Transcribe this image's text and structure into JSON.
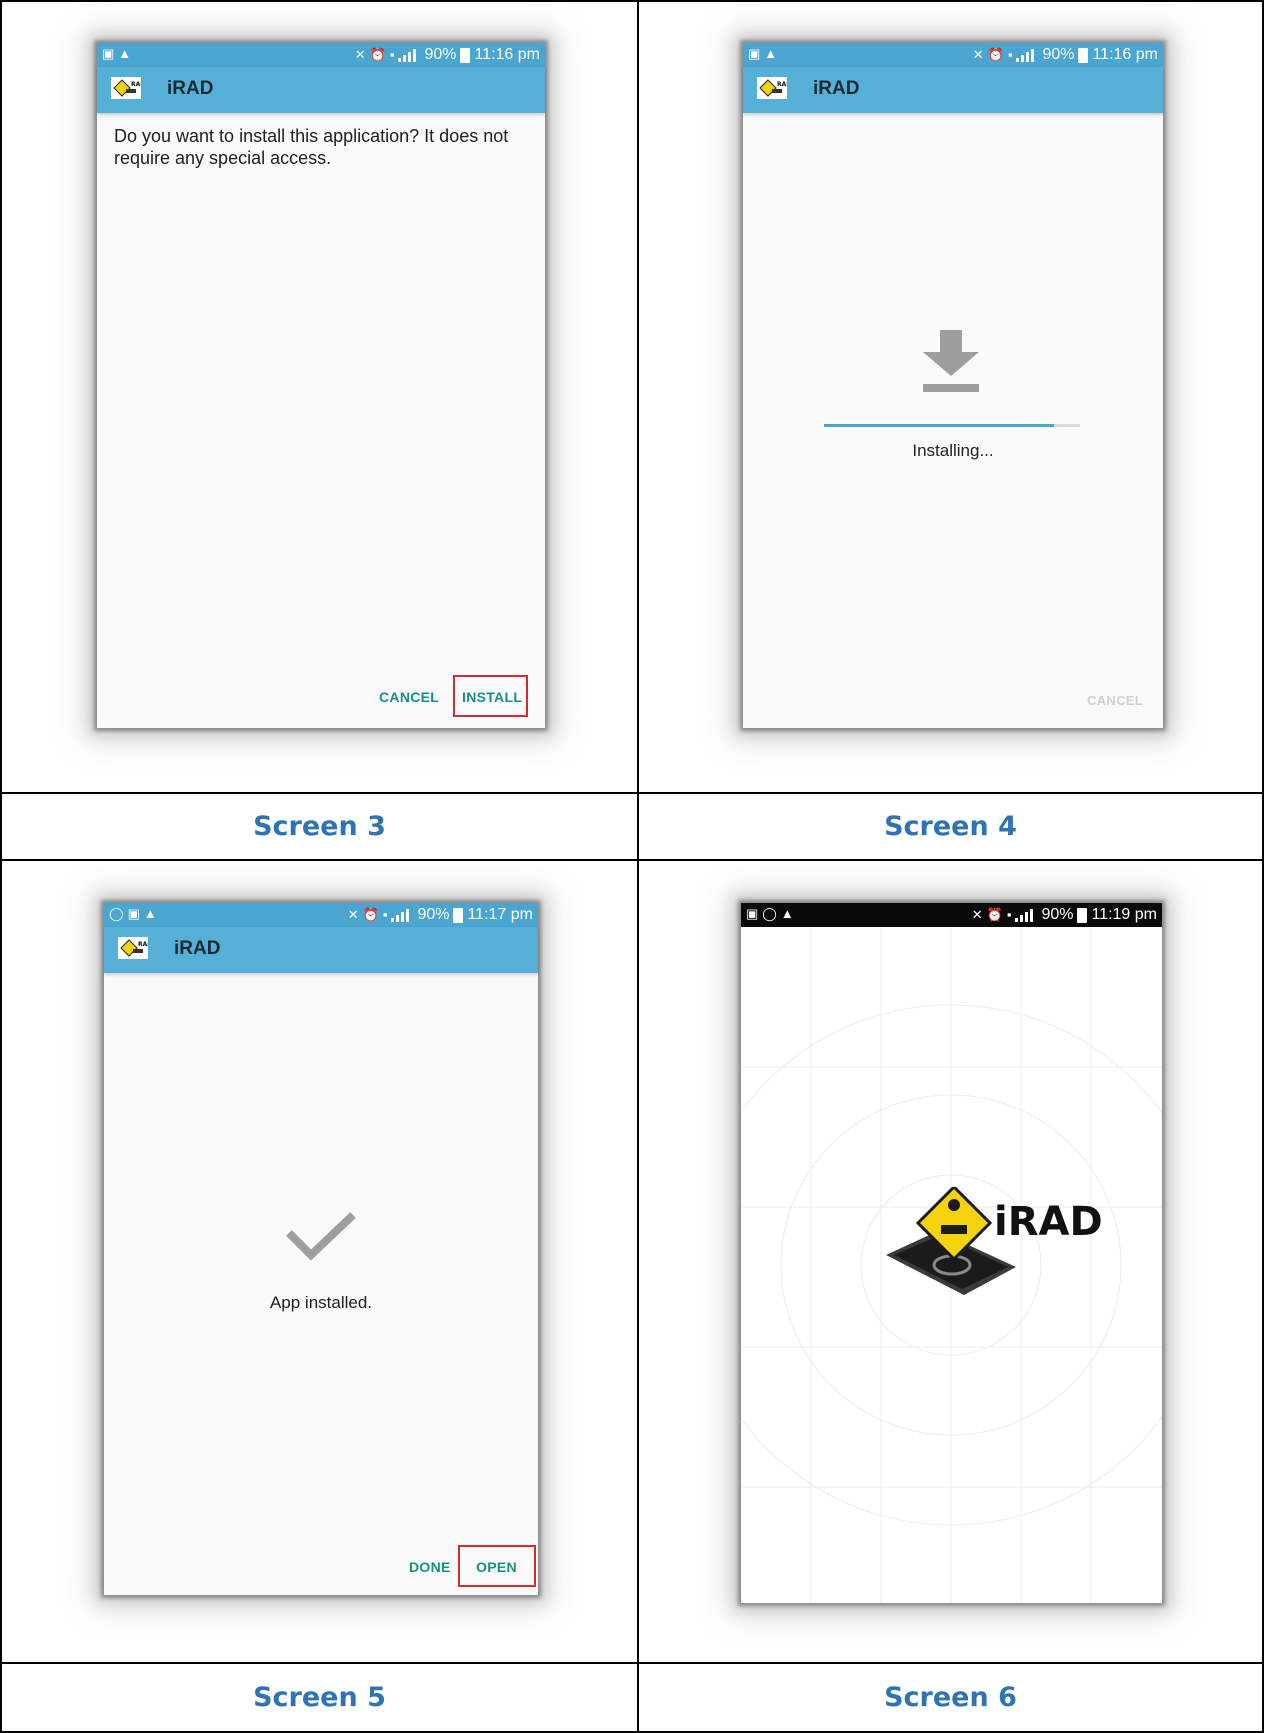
{
  "screens": [
    {
      "caption": "Screen 3",
      "status": {
        "time": "11:16 pm",
        "battery": "90%"
      },
      "app_title": "iRAD",
      "message": "Do you want to install this application? It does not require any special access.",
      "buttons": {
        "cancel": "CANCEL",
        "install": "INSTALL"
      },
      "highlighted_button": "INSTALL"
    },
    {
      "caption": "Screen 4",
      "status": {
        "time": "11:16 pm",
        "battery": "90%"
      },
      "app_title": "iRAD",
      "status_text": "Installing...",
      "progress": 0.9,
      "buttons": {
        "cancel": "CANCEL"
      },
      "icon": "download-arrow-icon"
    },
    {
      "caption": "Screen 5",
      "status": {
        "time": "11:17 pm",
        "battery": "90%"
      },
      "app_title": "iRAD",
      "status_text": "App installed.",
      "buttons": {
        "done": "DONE",
        "open": "OPEN"
      },
      "highlighted_button": "OPEN",
      "icon": "checkmark-icon"
    },
    {
      "caption": "Screen 6",
      "status": {
        "time": "11:19 pm",
        "battery": "90%"
      },
      "splash_logo_text": "iRAD",
      "icon": "irad-splash-logo"
    }
  ],
  "colors": {
    "caption": "#2e74b5",
    "status_bar": "#4aa6d0",
    "app_bar": "#55afd6",
    "button_text": "#168f86",
    "highlight_box": "#d12b33",
    "logo_yellow": "#f5d20e"
  }
}
